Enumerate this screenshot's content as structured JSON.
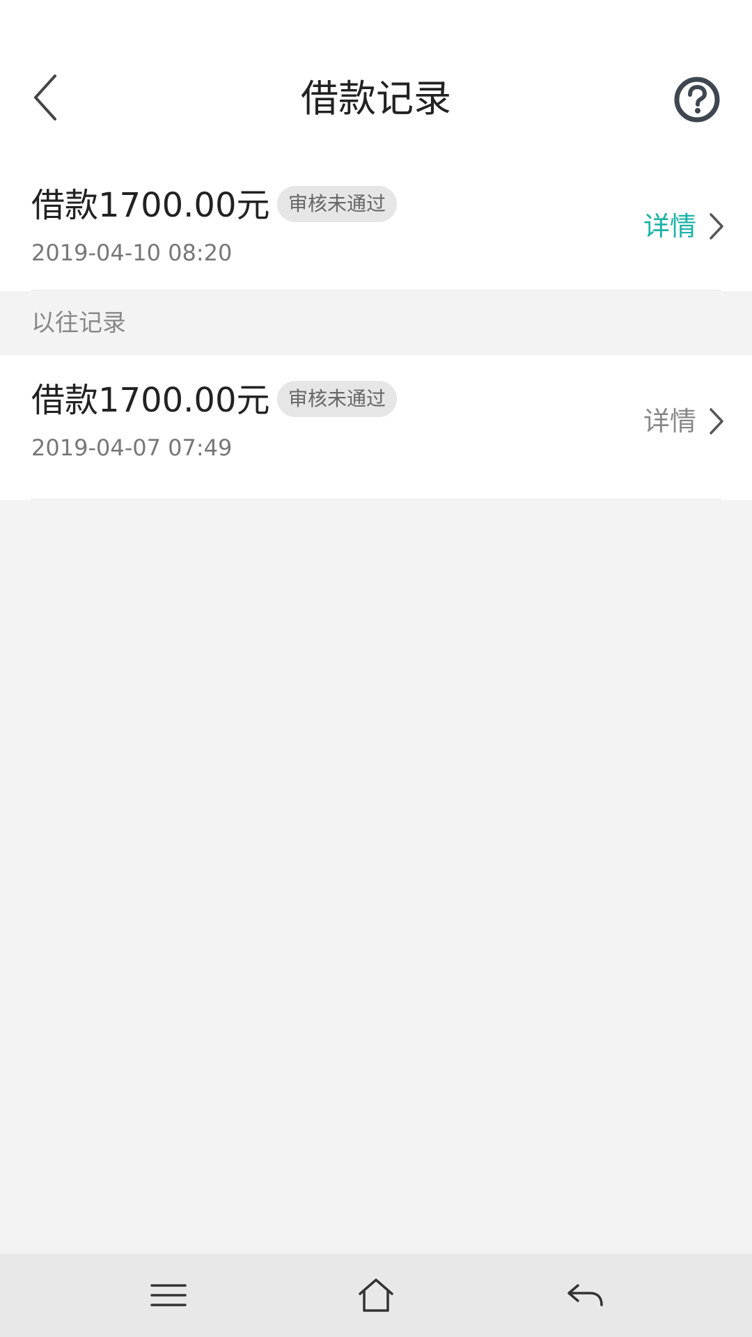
{
  "header": {
    "title": "借款记录",
    "back_icon": "chevron-left-icon",
    "help_icon": "question-circle-icon"
  },
  "current_record": {
    "amount": "借款1700.00元",
    "status": "审核未通过",
    "date": "2019-04-10 08:20",
    "detail_label": "详情",
    "detail_color": "#1ab3a6"
  },
  "history": {
    "section_label": "以往记录",
    "records": [
      {
        "amount": "借款1700.00元",
        "status": "审核未通过",
        "date": "2019-04-07 07:49",
        "detail_label": "详情",
        "detail_color": "#888888"
      }
    ]
  },
  "nav": {
    "menu_icon": "menu-icon",
    "home_icon": "home-icon",
    "back_icon": "return-icon"
  },
  "colors": {
    "accent": "#1ab3a6",
    "background": "#f3f3f3",
    "badge_bg": "#e6e6e6"
  }
}
